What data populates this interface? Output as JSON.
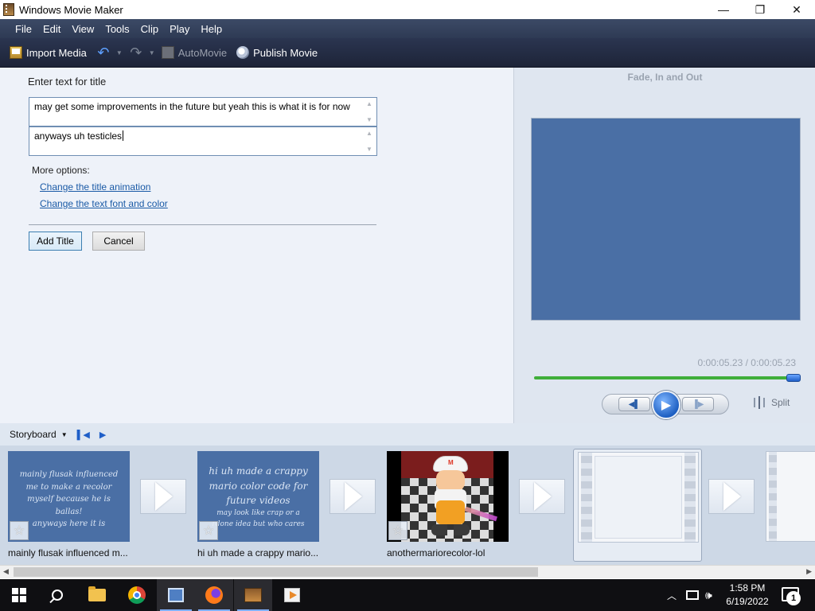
{
  "window": {
    "title": "Windows Movie Maker",
    "minimize_glyph": "—",
    "maximize_glyph": "❐",
    "close_glyph": "✕"
  },
  "menu": [
    "File",
    "Edit",
    "View",
    "Tools",
    "Clip",
    "Play",
    "Help"
  ],
  "toolbar": {
    "import_media": "Import Media",
    "automovie": "AutoMovie",
    "publish_movie": "Publish Movie"
  },
  "title_panel": {
    "label": "Enter text for title",
    "line1": "may get some improvements in the future but yeah this is what it is for now",
    "line2": "anyways uh testicles",
    "more_options": "More options:",
    "change_animation": "Change the title animation",
    "change_font": "Change the text font and color",
    "add_title": "Add Title",
    "cancel": "Cancel"
  },
  "preview": {
    "effect_name": "Fade, In and Out",
    "timecode": "0:00:05.23 / 0:00:05.23",
    "split": "Split",
    "position_fraction": 1.0,
    "background_color": "#4a6fa5"
  },
  "storyboard": {
    "label": "Storyboard",
    "clips": [
      {
        "label": "mainly flusak influenced m...",
        "thumb_lines": [
          "mainly flusak influenced",
          "me to make a recolor",
          "myself because he is ballas!",
          "anyways here it is"
        ]
      },
      {
        "label": "hi uh made a crappy mario...",
        "thumb_lines": [
          "hi uh made a crappy",
          "mario color code for",
          "future videos"
        ],
        "thumb_small_lines": [
          "may look like crap or a",
          "rdone idea but who cares"
        ]
      },
      {
        "label": "anothermariorecolor-lol"
      }
    ]
  },
  "taskbar": {
    "time": "1:58 PM",
    "date": "6/19/2022",
    "notification_count": "1"
  }
}
